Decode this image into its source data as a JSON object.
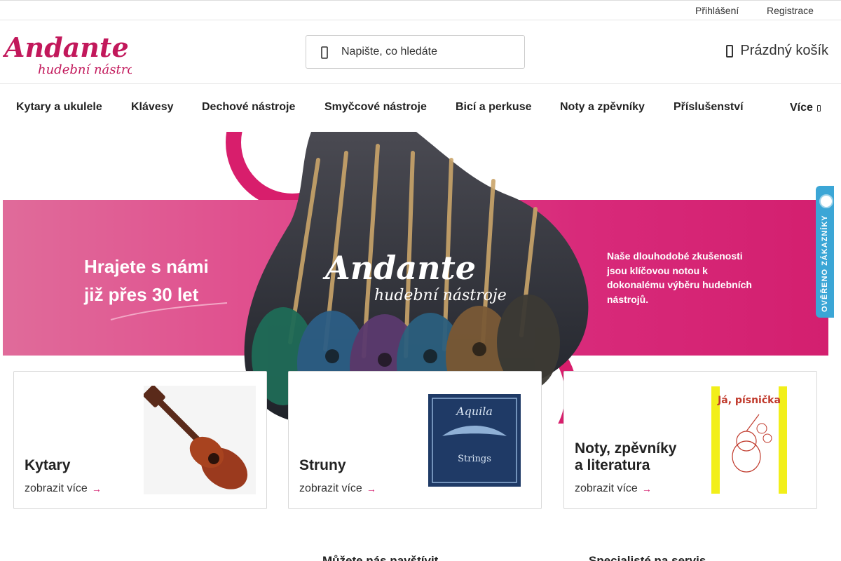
{
  "topbar": {
    "login": "Přihlášení",
    "register": "Registrace"
  },
  "header": {
    "logo_text": "Andante hudební nástroje",
    "search_placeholder": "Napište, co hledáte",
    "cart_label": "Prázdný košík"
  },
  "nav": {
    "items": [
      {
        "label": "Kytary a ukulele"
      },
      {
        "label": "Klávesy"
      },
      {
        "label": "Dechové nástroje"
      },
      {
        "label": "Smyčcové nástroje"
      },
      {
        "label": "Bicí a perkuse"
      },
      {
        "label": "Noty a zpěvníky"
      },
      {
        "label": "Příslušenství"
      }
    ],
    "more": "Více"
  },
  "hero": {
    "headline_line1": "Hrajete s námi",
    "headline_line2": "již přes 30 let",
    "tagline": "Naše dlouhodobé zkušenosti jsou klíčovou notou k dokonalému výběru hudebních nástrojů.",
    "colors": {
      "brand": "#d31f6f",
      "band_start": "#e06b9a"
    }
  },
  "verified": {
    "label": "OVĚŘENO ZÁKAZNÍKY",
    "color": "#3ba6d6"
  },
  "cards": [
    {
      "title_line1": "Kytary",
      "title_line2": "",
      "more": "zobrazit více"
    },
    {
      "title_line1": "Struny",
      "title_line2": "",
      "more": "zobrazit více",
      "image_text": "Aquila",
      "image_sub": "Strings"
    },
    {
      "title_line1": "Noty, zpěvníky",
      "title_line2": "a literatura",
      "more": "zobrazit více",
      "image_text": "Já, písnička"
    }
  ],
  "footer": {
    "visit": "Můžete nás navštívit",
    "service": "Specialisté na servis"
  }
}
